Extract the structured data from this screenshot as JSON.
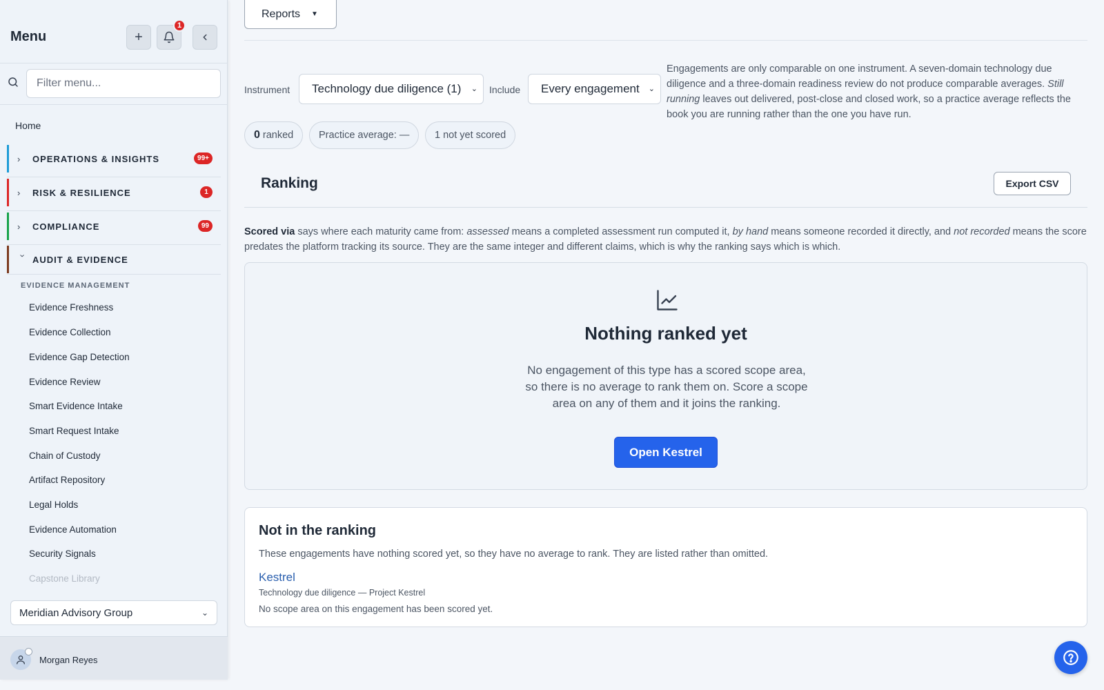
{
  "sidebar": {
    "title": "Menu",
    "notification_count": "1",
    "search_placeholder": "Filter menu...",
    "home_label": "Home",
    "sections": [
      {
        "label": "OPERATIONS & INSIGHTS",
        "badge": "99+",
        "accent": "#1d9bd7",
        "expanded": false
      },
      {
        "label": "RISK & RESILIENCE",
        "badge": "1",
        "accent": "#dc2626",
        "expanded": false
      },
      {
        "label": "COMPLIANCE",
        "badge": "99",
        "accent": "#16a34a",
        "expanded": false
      },
      {
        "label": "AUDIT & EVIDENCE",
        "badge": "",
        "accent": "#7c3a1f",
        "expanded": true
      }
    ],
    "subheading": "EVIDENCE MANAGEMENT",
    "items": [
      "Evidence Freshness",
      "Evidence Collection",
      "Evidence Gap Detection",
      "Evidence Review",
      "Smart Evidence Intake",
      "Smart Request Intake",
      "Chain of Custody",
      "Artifact Repository",
      "Legal Holds",
      "Evidence Automation",
      "Security Signals",
      "Capstone Library"
    ],
    "org_select": "Meridian Advisory Group",
    "user_name": "Morgan Reyes"
  },
  "main": {
    "reports_label": "Reports",
    "instrument_label": "Instrument",
    "instrument_value": "Technology due diligence (1)",
    "include_label": "Include",
    "include_value": "Every engagement",
    "explain_1": "Engagements are only comparable on one instrument. A seven-domain technology due diligence and a three-domain readiness review do not produce comparable averages.",
    "explain_2_em": "Still running",
    "explain_2": " leaves out delivered, post-close and closed work, so a practice average reflects the book you are running rather than the one you have run.",
    "chip_ranked_count": "0",
    "chip_ranked_label": "ranked",
    "chip_average": "Practice average: —",
    "chip_unscored": "1 not yet scored",
    "ranking_title": "Ranking",
    "export_label": "Export CSV",
    "scored_note": {
      "b": "Scored via",
      "t1": " says where each maturity came from: ",
      "e1": "assessed",
      "t2": " means a completed assessment run computed it, ",
      "e2": "by hand",
      "t3": " means someone recorded it directly, and ",
      "e3": "not recorded",
      "t4": " means the score predates the platform tracking its source. They are the same integer and different claims, which is why the ranking says which is which."
    },
    "empty_title": "Nothing ranked yet",
    "empty_text": "No engagement of this type has a scored scope area, so there is no average to rank them on. Score a scope area on any of them and it joins the ranking.",
    "open_button": "Open Kestrel",
    "not_in_ranking": {
      "title": "Not in the ranking",
      "desc": "These engagements have nothing scored yet, so they have no average to rank. They are listed rather than omitted.",
      "link": "Kestrel",
      "sub": "Technology due diligence — Project Kestrel",
      "note": "No scope area on this engagement has been scored yet."
    }
  },
  "colors": {
    "primary": "#2563eb",
    "badge": "#dc2626",
    "link": "#2a5fae"
  }
}
